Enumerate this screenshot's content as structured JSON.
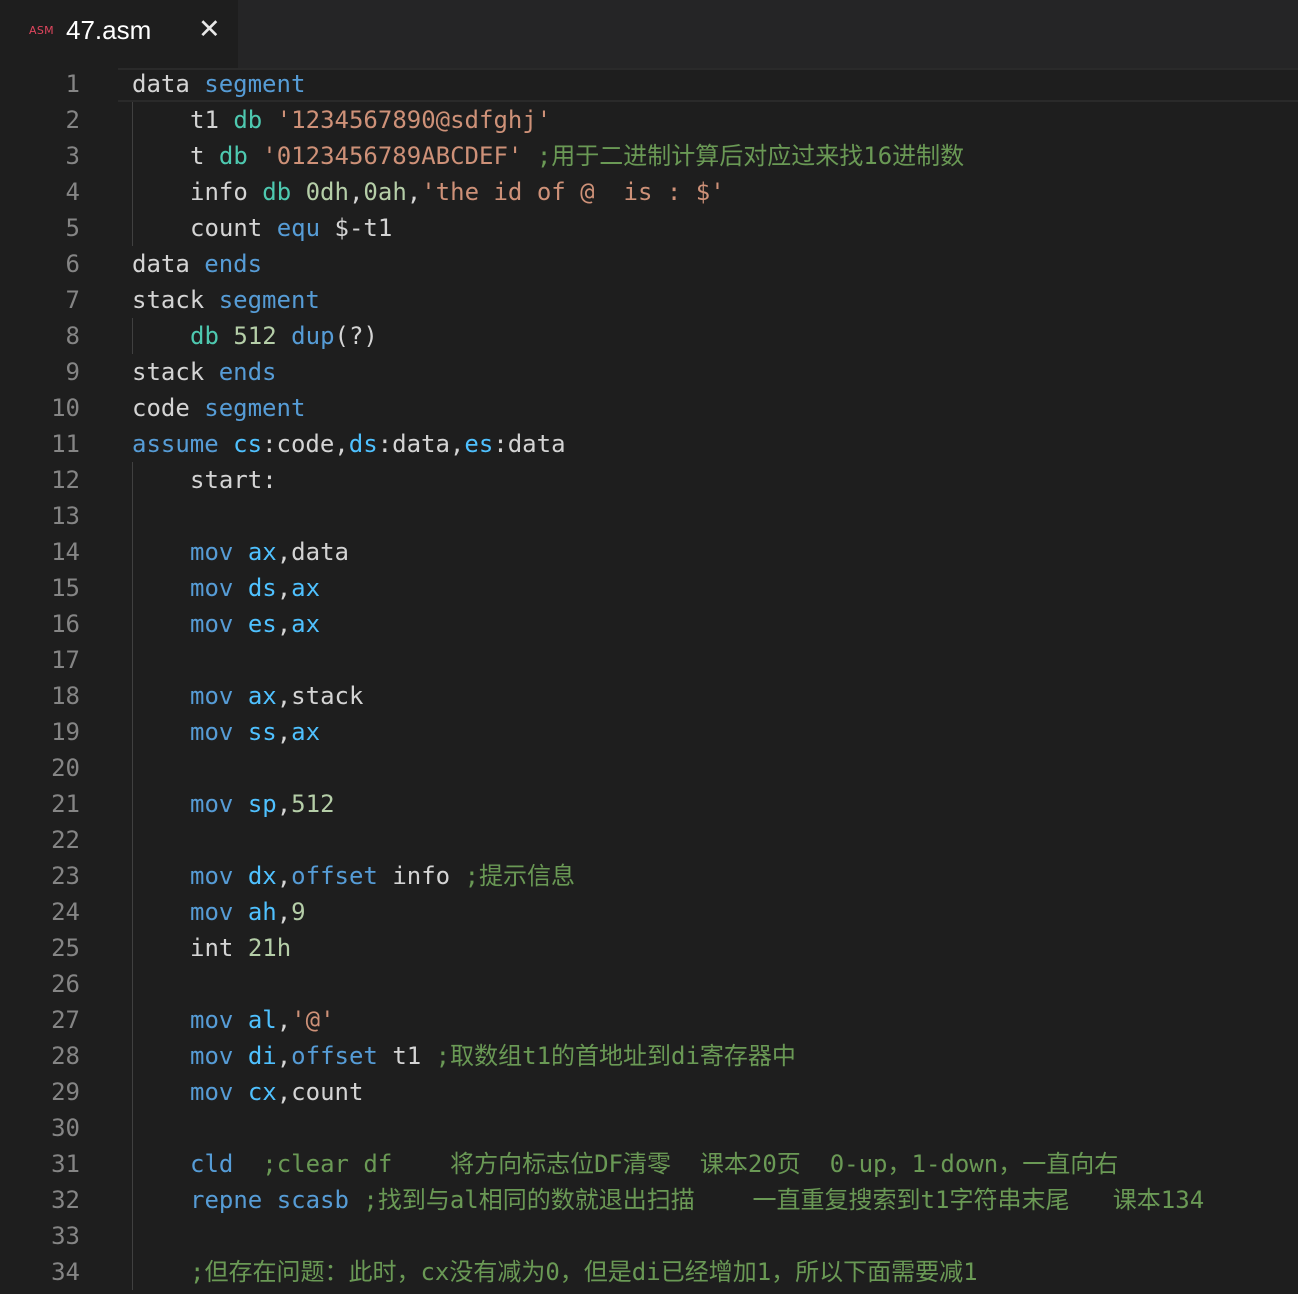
{
  "tab": {
    "icon_text": "ASM",
    "title": "47.asm",
    "close_glyph": "✕"
  },
  "editor": {
    "lines": [
      {
        "n": "1",
        "indent": 0,
        "tokens": [
          [
            "data",
            "plain"
          ],
          [
            " ",
            "plain"
          ],
          [
            "segment",
            "kw"
          ]
        ]
      },
      {
        "n": "2",
        "indent": 1,
        "tokens": [
          [
            "t1",
            "plain"
          ],
          [
            " ",
            "plain"
          ],
          [
            "db",
            "db"
          ],
          [
            " ",
            "plain"
          ],
          [
            "'1234567890@sdfghj'",
            "str"
          ]
        ]
      },
      {
        "n": "3",
        "indent": 1,
        "tokens": [
          [
            "t",
            "plain"
          ],
          [
            " ",
            "plain"
          ],
          [
            "db",
            "db"
          ],
          [
            " ",
            "plain"
          ],
          [
            "'0123456789ABCDEF'",
            "str"
          ],
          [
            " ",
            "plain"
          ],
          [
            ";用于二进制计算后对应过来找16进制数",
            "cmt"
          ]
        ]
      },
      {
        "n": "4",
        "indent": 1,
        "tokens": [
          [
            "info",
            "plain"
          ],
          [
            " ",
            "plain"
          ],
          [
            "db",
            "db"
          ],
          [
            " ",
            "plain"
          ],
          [
            "0dh",
            "num"
          ],
          [
            ",",
            "plain"
          ],
          [
            "0ah",
            "num"
          ],
          [
            ",",
            "plain"
          ],
          [
            "'the id of @  is : $'",
            "str"
          ]
        ]
      },
      {
        "n": "5",
        "indent": 1,
        "tokens": [
          [
            "count",
            "plain"
          ],
          [
            " ",
            "plain"
          ],
          [
            "equ",
            "kw"
          ],
          [
            " ",
            "plain"
          ],
          [
            "$-t1",
            "plain"
          ]
        ]
      },
      {
        "n": "6",
        "indent": 0,
        "tokens": [
          [
            "data",
            "plain"
          ],
          [
            " ",
            "plain"
          ],
          [
            "ends",
            "kw"
          ]
        ]
      },
      {
        "n": "7",
        "indent": 0,
        "tokens": [
          [
            "stack",
            "plain"
          ],
          [
            " ",
            "plain"
          ],
          [
            "segment",
            "kw"
          ]
        ]
      },
      {
        "n": "8",
        "indent": 1,
        "tokens": [
          [
            "db",
            "db"
          ],
          [
            " ",
            "plain"
          ],
          [
            "512",
            "num"
          ],
          [
            " ",
            "plain"
          ],
          [
            "dup",
            "kw"
          ],
          [
            "(?)",
            "plain"
          ]
        ]
      },
      {
        "n": "9",
        "indent": 0,
        "tokens": [
          [
            "stack",
            "plain"
          ],
          [
            " ",
            "plain"
          ],
          [
            "ends",
            "kw"
          ]
        ]
      },
      {
        "n": "10",
        "indent": 0,
        "tokens": [
          [
            "code",
            "plain"
          ],
          [
            " ",
            "plain"
          ],
          [
            "segment",
            "kw"
          ]
        ]
      },
      {
        "n": "11",
        "indent": 0,
        "tokens": [
          [
            "assume",
            "kw"
          ],
          [
            " ",
            "plain"
          ],
          [
            "cs",
            "reg"
          ],
          [
            ":code,",
            "plain"
          ],
          [
            "ds",
            "reg"
          ],
          [
            ":data,",
            "plain"
          ],
          [
            "es",
            "reg"
          ],
          [
            ":data",
            "plain"
          ]
        ]
      },
      {
        "n": "12",
        "indent": 1,
        "tokens": [
          [
            "start:",
            "plain"
          ]
        ]
      },
      {
        "n": "13",
        "indent": 1,
        "tokens": []
      },
      {
        "n": "14",
        "indent": 1,
        "tokens": [
          [
            "mov",
            "kw"
          ],
          [
            " ",
            "plain"
          ],
          [
            "ax",
            "reg"
          ],
          [
            ",data",
            "plain"
          ]
        ]
      },
      {
        "n": "15",
        "indent": 1,
        "tokens": [
          [
            "mov",
            "kw"
          ],
          [
            " ",
            "plain"
          ],
          [
            "ds",
            "reg"
          ],
          [
            ",",
            "plain"
          ],
          [
            "ax",
            "reg"
          ]
        ]
      },
      {
        "n": "16",
        "indent": 1,
        "tokens": [
          [
            "mov",
            "kw"
          ],
          [
            " ",
            "plain"
          ],
          [
            "es",
            "reg"
          ],
          [
            ",",
            "plain"
          ],
          [
            "ax",
            "reg"
          ]
        ]
      },
      {
        "n": "17",
        "indent": 1,
        "tokens": []
      },
      {
        "n": "18",
        "indent": 1,
        "tokens": [
          [
            "mov",
            "kw"
          ],
          [
            " ",
            "plain"
          ],
          [
            "ax",
            "reg"
          ],
          [
            ",stack",
            "plain"
          ]
        ]
      },
      {
        "n": "19",
        "indent": 1,
        "tokens": [
          [
            "mov",
            "kw"
          ],
          [
            " ",
            "plain"
          ],
          [
            "ss",
            "reg"
          ],
          [
            ",",
            "plain"
          ],
          [
            "ax",
            "reg"
          ]
        ]
      },
      {
        "n": "20",
        "indent": 1,
        "tokens": []
      },
      {
        "n": "21",
        "indent": 1,
        "tokens": [
          [
            "mov",
            "kw"
          ],
          [
            " ",
            "plain"
          ],
          [
            "sp",
            "reg"
          ],
          [
            ",",
            "plain"
          ],
          [
            "512",
            "num"
          ]
        ]
      },
      {
        "n": "22",
        "indent": 1,
        "tokens": []
      },
      {
        "n": "23",
        "indent": 1,
        "tokens": [
          [
            "mov",
            "kw"
          ],
          [
            " ",
            "plain"
          ],
          [
            "dx",
            "reg"
          ],
          [
            ",",
            "plain"
          ],
          [
            "offset",
            "kw"
          ],
          [
            " info ",
            "plain"
          ],
          [
            ";提示信息",
            "cmt"
          ]
        ]
      },
      {
        "n": "24",
        "indent": 1,
        "tokens": [
          [
            "mov",
            "kw"
          ],
          [
            " ",
            "plain"
          ],
          [
            "ah",
            "reg"
          ],
          [
            ",",
            "plain"
          ],
          [
            "9",
            "num"
          ]
        ]
      },
      {
        "n": "25",
        "indent": 1,
        "tokens": [
          [
            "int",
            "plain"
          ],
          [
            " ",
            "plain"
          ],
          [
            "21h",
            "num"
          ]
        ]
      },
      {
        "n": "26",
        "indent": 1,
        "tokens": []
      },
      {
        "n": "27",
        "indent": 1,
        "tokens": [
          [
            "mov",
            "kw"
          ],
          [
            " ",
            "plain"
          ],
          [
            "al",
            "reg"
          ],
          [
            ",",
            "plain"
          ],
          [
            "'@'",
            "str"
          ]
        ]
      },
      {
        "n": "28",
        "indent": 1,
        "tokens": [
          [
            "mov",
            "kw"
          ],
          [
            " ",
            "plain"
          ],
          [
            "di",
            "reg"
          ],
          [
            ",",
            "plain"
          ],
          [
            "offset",
            "kw"
          ],
          [
            " t1 ",
            "plain"
          ],
          [
            ";取数组t1的首地址到di寄存器中",
            "cmt"
          ]
        ]
      },
      {
        "n": "29",
        "indent": 1,
        "tokens": [
          [
            "mov",
            "kw"
          ],
          [
            " ",
            "plain"
          ],
          [
            "cx",
            "reg"
          ],
          [
            ",count",
            "plain"
          ]
        ]
      },
      {
        "n": "30",
        "indent": 1,
        "tokens": []
      },
      {
        "n": "31",
        "indent": 1,
        "tokens": [
          [
            "cld",
            "kw"
          ],
          [
            "  ",
            "plain"
          ],
          [
            ";clear df    将方向标志位DF清零  课本20页  0-up，1-down，一直向右",
            "cmt"
          ]
        ]
      },
      {
        "n": "32",
        "indent": 1,
        "tokens": [
          [
            "repne",
            "kw"
          ],
          [
            " ",
            "plain"
          ],
          [
            "scasb",
            "kw"
          ],
          [
            " ",
            "plain"
          ],
          [
            ";找到与al相同的数就退出扫描    一直重复搜索到t1字符串末尾   课本134",
            "cmt"
          ]
        ]
      },
      {
        "n": "33",
        "indent": 1,
        "tokens": []
      },
      {
        "n": "34",
        "indent": 1,
        "tokens": [
          [
            ";但存在问题：此时，cx没有减为0，但是di已经增加1，所以下面需要减1",
            "cmt"
          ]
        ]
      }
    ]
  },
  "colors": {
    "background": "#1e1e1e",
    "tab_bar": "#252526",
    "line_number": "#858585",
    "keyword": "#569cd6",
    "register": "#4fc1ff",
    "string": "#ce9178",
    "number": "#b5cea8",
    "directive": "#4ec9b0",
    "comment": "#6a9955"
  }
}
